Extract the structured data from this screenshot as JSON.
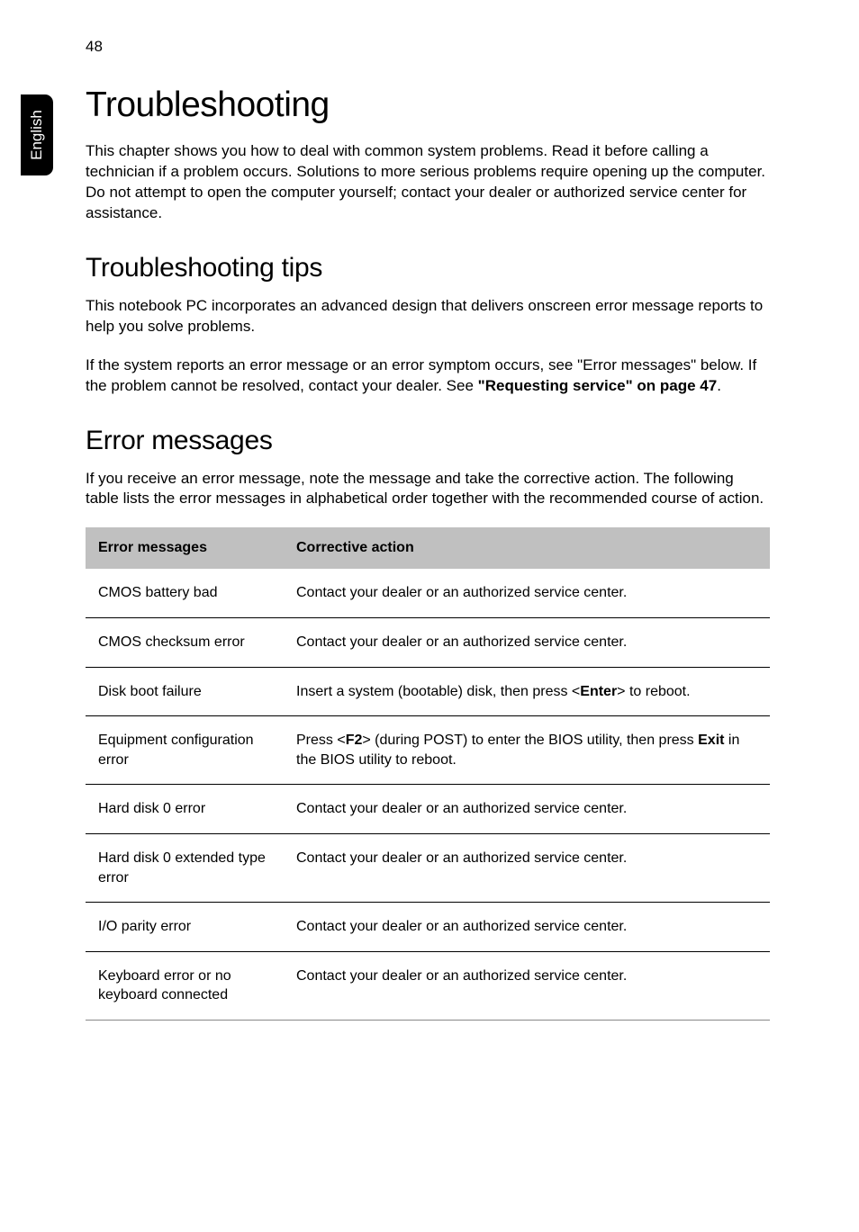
{
  "page_number": "48",
  "side_tab": "English",
  "title": "Troubleshooting",
  "intro": "This chapter shows you how to deal with common system problems. Read it before calling a technician if a problem occurs. Solutions to more serious problems require opening up the computer. Do not attempt to open the computer yourself; contact your dealer or authorized service center for assistance.",
  "tips_heading": "Troubleshooting tips",
  "tips_p1": "This notebook PC incorporates an advanced design that delivers onscreen error message reports to help you solve problems.",
  "tips_p2_a": "If the system reports an error message or an error symptom occurs, see \"Error messages\" below. If the problem cannot be resolved, contact your dealer. See ",
  "tips_p2_b": "\"Requesting service\" on page 47",
  "tips_p2_c": ".",
  "err_heading": "Error messages",
  "err_intro": "If you receive an error message, note the message and take the corrective action. The following table lists the error messages in alphabetical order together with the recommended course of action.",
  "table": {
    "col1": "Error messages",
    "col2": "Corrective action",
    "rows": [
      {
        "msg": "CMOS battery bad",
        "action_plain": "Contact your dealer or an authorized service center."
      },
      {
        "msg": "CMOS checksum error",
        "action_plain": "Contact your dealer or an authorized service center."
      },
      {
        "msg": "Disk boot failure",
        "action_pre": "Insert a system (bootable) disk, then press <",
        "action_b1": "Enter",
        "action_post": "> to reboot."
      },
      {
        "msg": "Equipment configuration error",
        "action_pre": "Press <",
        "action_b1": "F2",
        "action_mid": "> (during POST) to enter the BIOS utility, then press ",
        "action_b2": "Exit",
        "action_post": " in the BIOS utility to reboot."
      },
      {
        "msg": "Hard disk 0 error",
        "action_plain": "Contact your dealer or an authorized service center."
      },
      {
        "msg": "Hard disk 0 extended type error",
        "action_plain": "Contact your dealer or an authorized service center."
      },
      {
        "msg": "I/O parity error",
        "action_plain": "Contact your dealer or an authorized service center."
      },
      {
        "msg": "Keyboard error or no keyboard connected",
        "action_plain": "Contact your dealer or an authorized service center."
      }
    ]
  }
}
